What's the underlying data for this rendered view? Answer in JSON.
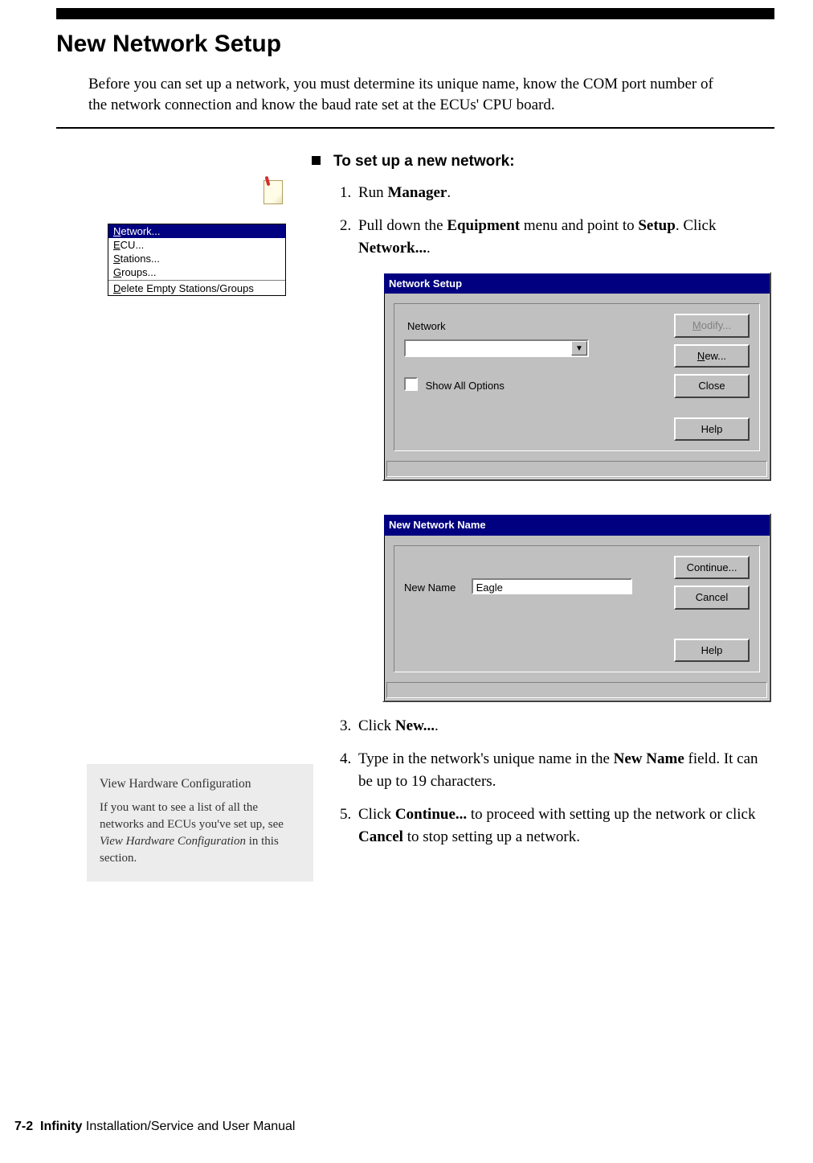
{
  "page": {
    "title": "New Network Setup",
    "intro": "Before you can set up a network, you must determine its unique name, know the COM port number of the network connection and know the baud rate set at the ECUs' CPU board."
  },
  "menu": {
    "items": [
      {
        "html": "<span class='ul'>N</span>etwork...",
        "selected": true
      },
      {
        "html": "<span class='ul'>E</span>CU..."
      },
      {
        "html": "<span class='ul'>S</span>tations..."
      },
      {
        "html": "<span class='ul'>G</span>roups..."
      },
      {
        "html": "<span class='ul'>D</span>elete Empty Stations/Groups"
      }
    ]
  },
  "procedure": {
    "heading": "To set up a new network:",
    "step1_pre": "Run ",
    "step1_b": "Manager",
    "step2_a": "Pull down the ",
    "step2_b1": "Equipment",
    "step2_c": " menu and point to ",
    "step2_b2": "Setup",
    "step2_d": ". Click ",
    "step2_b3": "Network...",
    "step3_a": "Click ",
    "step3_b": "New...",
    "step4_a": "Type in the network's unique name in the ",
    "step4_b": "New Name",
    "step4_c": " field. It can be up to 19 characters.",
    "step5_a": "Click ",
    "step5_b1": "Continue...",
    "step5_c": " to proceed with setting up the network or click ",
    "step5_b2": "Cancel",
    "step5_d": " to stop setting up a network."
  },
  "dialog1": {
    "title": "Network Setup",
    "label_network": "Network",
    "chk_label_html": "Show <span class='ul'>A</span>ll Options",
    "btn_modify_html": "<span class='ul'>M</span>odify...",
    "btn_new_html": "<span class='ul'>N</span>ew...",
    "btn_close": "Close",
    "btn_help": "Help"
  },
  "dialog2": {
    "title": "New Network Name",
    "label_newname": "New Name",
    "value": "Eagle",
    "btn_continue": "Continue...",
    "btn_cancel": "Cancel",
    "btn_help": "Help"
  },
  "sidebar": {
    "title": "View Hardware Configuration",
    "body_a": "If you want to see a list of all the networks and ECUs you've set up, see ",
    "body_i": "View Hardware Configuration",
    "body_b": " in this section."
  },
  "footer": {
    "pagenum": "7-2",
    "product": "Infinity",
    "rest": " Installation/Service and User Manual"
  }
}
